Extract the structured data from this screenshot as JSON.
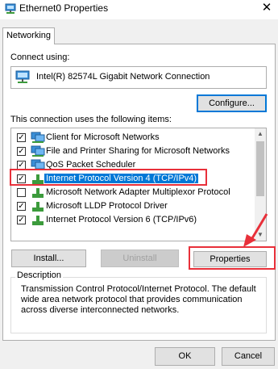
{
  "window": {
    "title": "Ethernet0 Properties",
    "title_icon": "network-adapter-icon",
    "close_glyph": "✕"
  },
  "tabs": [
    {
      "label": "Networking",
      "selected": true
    }
  ],
  "connect_using": {
    "label": "Connect using:",
    "adapter_name": "Intel(R) 82574L Gigabit Network Connection",
    "adapter_icon": "network-adapter-icon"
  },
  "buttons": {
    "configure": "Configure...",
    "install": "Install...",
    "uninstall": "Uninstall",
    "properties": "Properties",
    "ok": "OK",
    "cancel": "Cancel"
  },
  "items": {
    "label": "This connection uses the following items:",
    "list": [
      {
        "label": "Client for Microsoft Networks",
        "checked": true,
        "icon": "client-network-icon"
      },
      {
        "label": "File and Printer Sharing for Microsoft Networks",
        "checked": true,
        "icon": "client-network-icon"
      },
      {
        "label": "QoS Packet Scheduler",
        "checked": true,
        "icon": "client-network-icon"
      },
      {
        "label": "Internet Protocol Version 4 (TCP/IPv4)",
        "checked": true,
        "selected": true,
        "icon": "protocol-icon"
      },
      {
        "label": "Microsoft Network Adapter Multiplexor Protocol",
        "checked": false,
        "icon": "protocol-icon"
      },
      {
        "label": "Microsoft LLDP Protocol Driver",
        "checked": true,
        "icon": "protocol-icon"
      },
      {
        "label": "Internet Protocol Version 6 (TCP/IPv6)",
        "checked": true,
        "icon": "protocol-icon"
      }
    ]
  },
  "description": {
    "legend": "Description",
    "text": "Transmission Control Protocol/Internet Protocol. The default wide area network protocol that provides communication across diverse interconnected networks."
  },
  "colors": {
    "selection": "#0078d7",
    "annotation_red": "#e8303a"
  }
}
